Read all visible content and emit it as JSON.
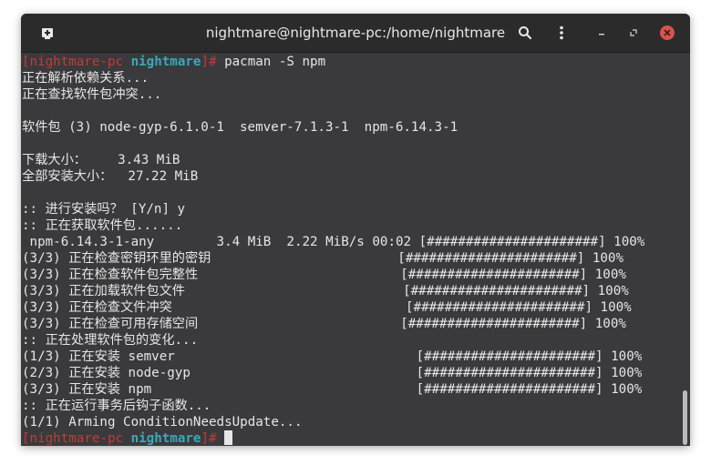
{
  "window": {
    "title": "nightmare@nightmare-pc:/home/nightmare",
    "colors": {
      "titlebar": "#2b2b2b",
      "terminal_bg": "#3a3a3c",
      "close": "#d9534f",
      "prompt_host": "#c23b3b",
      "prompt_dir": "#38aab9"
    }
  },
  "terminal": {
    "lines": [
      "[nightmare-pc nightmare]# pacman -S npm",
      "正在解析依赖关系...",
      "正在查找软件包冲突...",
      "",
      "软件包 (3) node-gyp-6.1.0-1  semver-7.1.3-1  npm-6.14.3-1",
      "",
      "下载大小：    3.43 MiB",
      "全部安装大小：  27.22 MiB",
      "",
      ":: 进行安装吗？ [Y/n] y",
      ":: 正在获取软件包......",
      " npm-6.14.3-1-any        3.4 MiB  2.22 MiB/s 00:02 [######################] 100%",
      "(3/3) 正在检查密钥环里的密钥                        [######################] 100%",
      "(3/3) 正在检查软件包完整性                          [######################] 100%",
      "(3/3) 正在加载软件包文件                            [######################] 100%",
      "(3/3) 正在检查文件冲突                              [######################] 100%",
      "(3/3) 正在检查可用存储空间                          [######################] 100%",
      ":: 正在处理软件包的变化...",
      "(1/3) 正在安装 semver                               [######################] 100%",
      "(2/3) 正在安装 node-gyp                             [######################] 100%",
      "(3/3) 正在安装 npm                                  [######################] 100%",
      ":: 正在运行事务后钩子函数...",
      "(1/1) Arming ConditionNeedsUpdate...",
      "[nightmare-pc nightmare]# "
    ]
  }
}
